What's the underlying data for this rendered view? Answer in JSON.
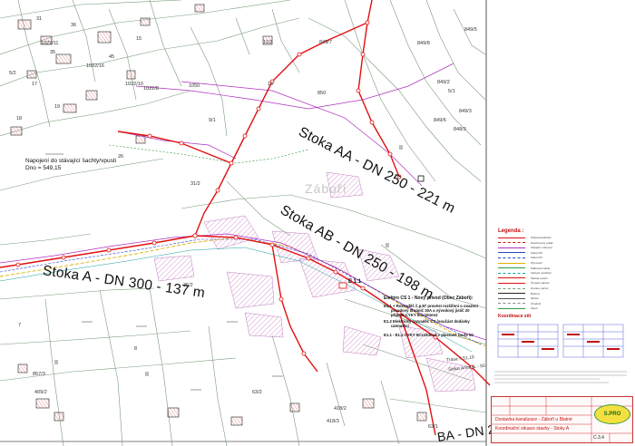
{
  "map": {
    "sewer_labels": [
      {
        "id": "aa",
        "text": "Stoka AA - DN 250 - 221 m"
      },
      {
        "id": "ab",
        "text": "Stoka AB - DN 250 - 198 m"
      },
      {
        "id": "a",
        "text": "Stoka A - DN 300 - 137 m"
      },
      {
        "id": "b",
        "text": "BA - DN 2"
      }
    ],
    "village": "Záboří",
    "connection_note": [
      "Napojení do stávající šachty/vpusti",
      "Dno = 549,15"
    ],
    "electro_notes": [
      "Elektro ČS 1 - Nový přívod (Obec Záboří):",
      "E1.1 + Rozvaděč č.p.87 provést rozšíření o osazení",
      "proudový chránič 30A a vývodový jistič 20",
      "přípojit CYKY 5Cx10mm2",
      "E1.2 Elektrický rozvaděč ČS (součást dodávky",
      "uzemnění",
      "E1.1 - E1.2  CYKY 5Cx10mm2 v plastové rouře 50"
    ],
    "node_label": "E 1.1",
    "road_note": [
      "Trasa = 51,10",
      "Stoka AmmaL - 50"
    ],
    "parcels": [
      "11/2",
      "849/7",
      "1022/11",
      "1022/16",
      "1022/10",
      "1022/8",
      "1050",
      "9/1",
      "5/2",
      "17",
      "18",
      "19",
      "26",
      "35",
      "36",
      "31",
      "45",
      "15",
      "16",
      "7",
      "8",
      "II",
      "II",
      "II",
      "II",
      "857/3",
      "409/2",
      "418/2",
      "418/3",
      "63/1",
      "63/2",
      "35/2",
      "31/2",
      "5/1",
      "849/8",
      "849/6",
      "848/3",
      "849/5",
      "849/2",
      "849/3",
      "850"
    ]
  },
  "legend": {
    "title": "Legenda :",
    "subtitle": "Koordinace sítí",
    "rows": [
      "Stoka kanalizace",
      "Navrhovaný výtlak",
      "Stávající vodovod",
      "Kabel NN",
      "Kabel VN",
      "Plynovod",
      "Sdělovací kabel",
      "Veřejné osvětlení",
      "Šachta revizní",
      "Čerpací stanice",
      "Hranice parcel",
      "Budovy",
      "Silnice",
      "Chodník",
      "Zeleň"
    ]
  },
  "title_block": {
    "rows": [
      "Dostavba kanalizace - Záboří u Blatné",
      "Koordinační situace stavby - Stoky A"
    ],
    "logo": "S.PRO",
    "number": "C.3.4"
  },
  "colors": {
    "sewer": "#e01010",
    "water": "#a020c0",
    "gas": "#e0b000",
    "cable": "#3040d0",
    "parcel": "#7a9a7a",
    "building_hatch": "#d9a0d0",
    "text": "#111111"
  }
}
